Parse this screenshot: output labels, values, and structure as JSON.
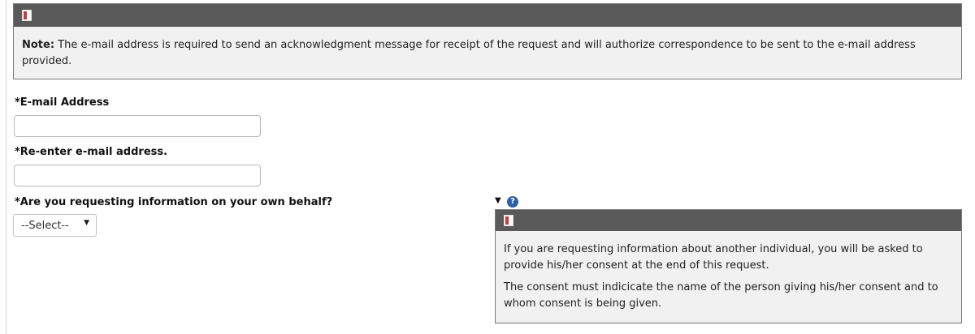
{
  "note": {
    "label": "Note:",
    "text": " The e-mail address is required to send an acknowledgment message for receipt of the request and will authorize correspondence to be sent to the e-mail address provided."
  },
  "form": {
    "email_label": "*E-mail Address",
    "email_value": "",
    "reenter_label": "*Re-enter e-mail address.",
    "reenter_value": "",
    "own_behalf_label": "*Are you requesting information on your own behalf?",
    "own_behalf_select": "--Select--"
  },
  "help": {
    "paragraph1": "If you are requesting information about another individual, you will be asked to provide his/her consent at the end of this request.",
    "paragraph2": "The consent must indicicate the name of the person giving his/her consent and to whom consent is being given."
  },
  "icons": {
    "panel_header": "document-icon",
    "help": "question-mark-icon",
    "toggle": "triangle-down-icon"
  },
  "colors": {
    "panel_header_bg": "#5a5a5a",
    "panel_bg": "#f1f1f1",
    "help_icon": "#2e5ea8"
  }
}
